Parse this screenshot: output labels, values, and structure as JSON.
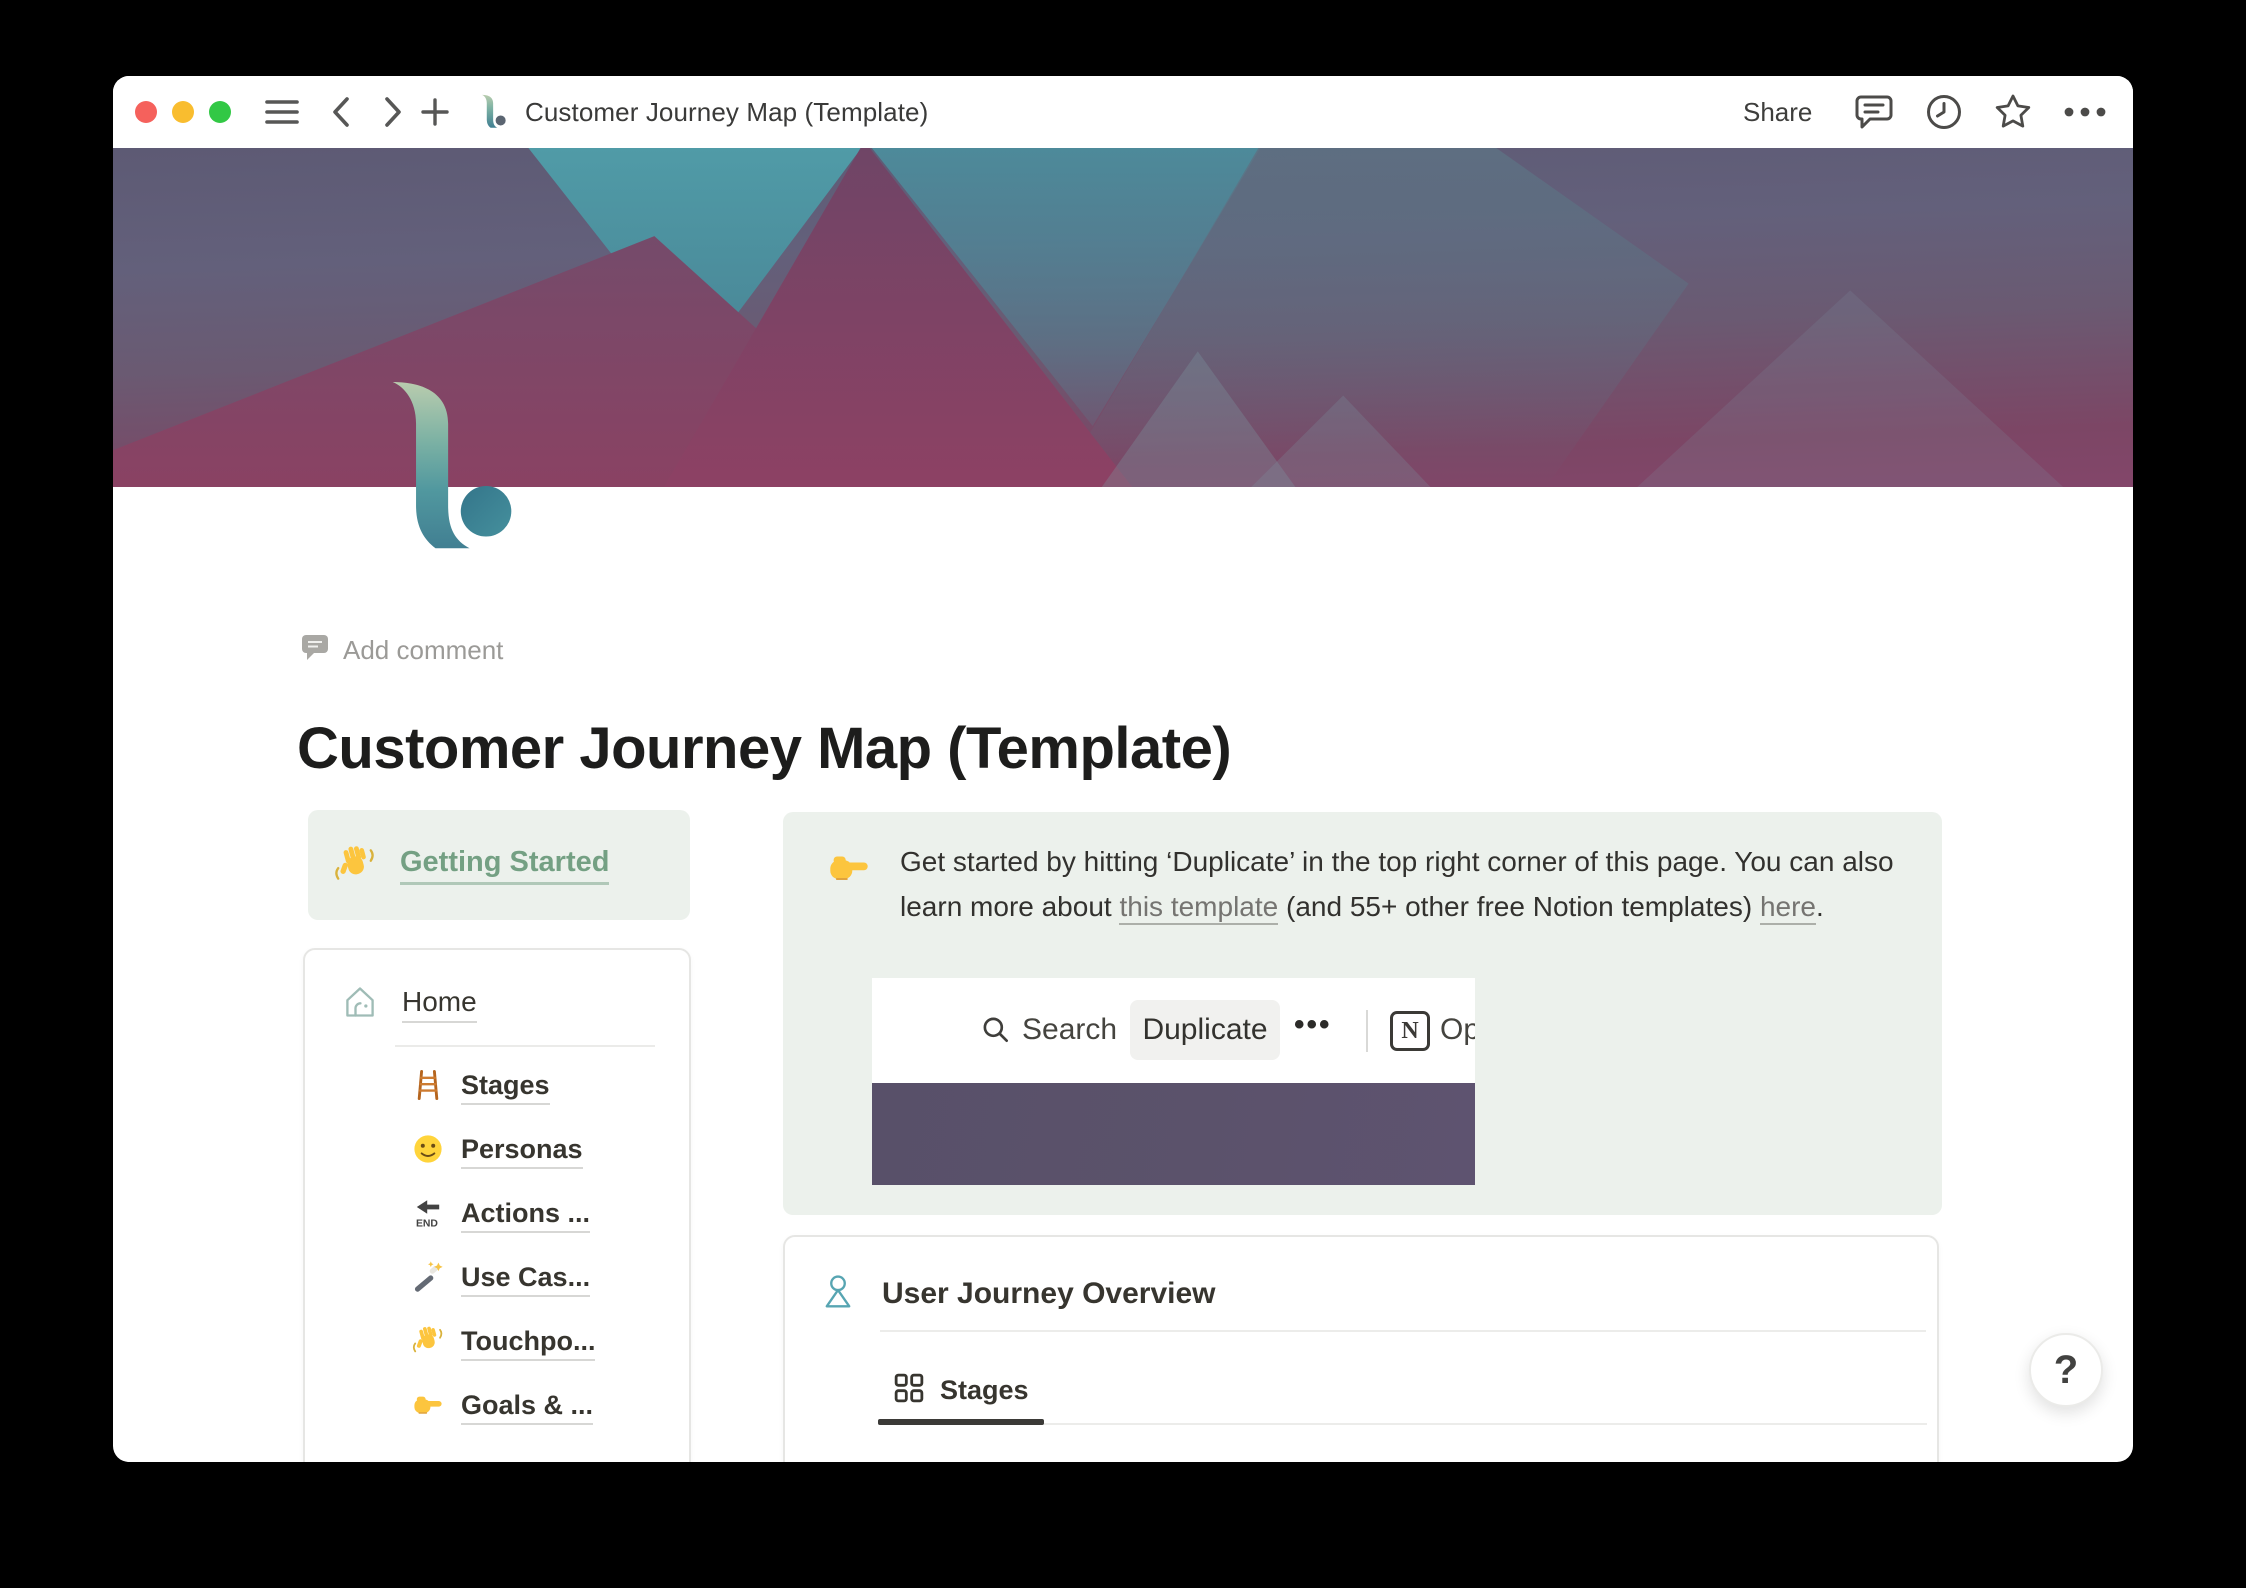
{
  "titlebar": {
    "title": "Customer Journey Map (Template)",
    "share": "Share",
    "traffic_lights": {
      "close": "#f5615c",
      "minimize": "#f9bd2f",
      "zoom": "#32c845"
    }
  },
  "page": {
    "add_comment": "Add comment",
    "title": "Customer Journey Map (Template)",
    "getting_started": {
      "icon": "waving-hand-emoji",
      "label": "Getting Started"
    },
    "home": {
      "icon": "house-icon",
      "label": "Home",
      "items": [
        {
          "icon": "ladder-emoji",
          "label": "Stages"
        },
        {
          "icon": "smiling-face-emoji",
          "label": "Personas"
        },
        {
          "icon": "end-arrow-emoji",
          "label": "Actions ..."
        },
        {
          "icon": "magic-wand-emoji",
          "label": "Use Cas..."
        },
        {
          "icon": "waving-hand-emoji",
          "label": "Touchpo..."
        },
        {
          "icon": "pointing-right-emoji",
          "label": "Goals & ..."
        }
      ]
    },
    "callout": {
      "icon": "pointing-right-emoji",
      "text1": "Get started by hitting ‘Duplicate’ in the top right corner of this page. You can also learn more about ",
      "link1": "this template",
      "text2": " (and 55+ other free Notion templates) ",
      "link2": "here",
      "text3": "."
    },
    "embed_screenshot": {
      "search": "Search",
      "duplicate": "Duplicate",
      "more": "•••",
      "notion_logo": "N",
      "open": "Op"
    },
    "overview": {
      "icon": "person-icon",
      "title": "User Journey Overview",
      "tabs": [
        {
          "icon": "grid-icon",
          "label": "Stages",
          "active": true
        }
      ]
    },
    "help": "?"
  },
  "colors": {
    "accent_green_text": "#74a083",
    "callout_bg": "#ecf1ec",
    "cover_teal": "#509ba7",
    "cover_maroon": "#8a4263",
    "embed_purple": "#5b526b",
    "dark_text": "#37352f"
  }
}
